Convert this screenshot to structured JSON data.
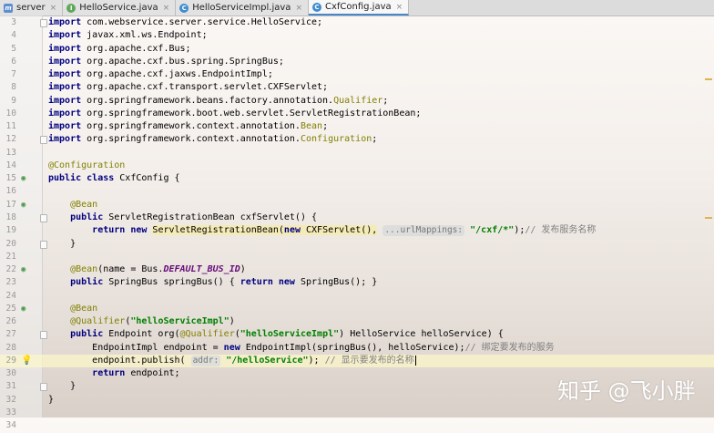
{
  "tabs": [
    {
      "label": "server",
      "icon": "module-icon",
      "active": false
    },
    {
      "label": "HelloService.java",
      "icon": "interface-icon",
      "active": false
    },
    {
      "label": "HelloServiceImpl.java",
      "icon": "class-icon",
      "active": false
    },
    {
      "label": "CxfConfig.java",
      "icon": "class-icon",
      "active": true
    }
  ],
  "close_glyph": "×",
  "line_numbers": [
    "3",
    "4",
    "5",
    "6",
    "7",
    "8",
    "9",
    "10",
    "11",
    "12",
    "13",
    "14",
    "15",
    "16",
    "17",
    "18",
    "19",
    "20",
    "21",
    "22",
    "23",
    "24",
    "25",
    "26",
    "27",
    "28",
    "29",
    "30",
    "31",
    "32",
    "33",
    "34"
  ],
  "code": {
    "import_kw": "import",
    "imports": [
      {
        "path": "com.webservice.server.service.HelloService",
        "tail": "",
        "end": ";"
      },
      {
        "path": "javax.xml.ws.Endpoint",
        "tail": "",
        "end": ";"
      },
      {
        "path": "org.apache.cxf.Bus",
        "tail": "",
        "end": ";"
      },
      {
        "path": "org.apache.cxf.bus.spring.SpringBus",
        "tail": "",
        "end": ";"
      },
      {
        "path": "org.apache.cxf.jaxws.EndpointImpl",
        "tail": "",
        "end": ";"
      },
      {
        "path": "org.apache.cxf.transport.servlet.CXFServlet",
        "tail": "",
        "end": ";"
      },
      {
        "path": "org.springframework.beans.factory.annotation.",
        "tail": "Qualifier",
        "end": ";"
      },
      {
        "path": "org.springframework.boot.web.servlet.ServletRegistrationBean",
        "tail": "",
        "end": ";"
      },
      {
        "path": "org.springframework.context.annotation.",
        "tail": "Bean",
        "end": ";"
      },
      {
        "path": "org.springframework.context.annotation.",
        "tail": "Configuration",
        "end": ";"
      }
    ],
    "annotation_configuration": "@Configuration",
    "kw_public": "public",
    "kw_class": "class",
    "class_decl_rest": " CxfConfig {",
    "annotation_bean": "@Bean",
    "servlet_sig_rest": " ServletRegistrationBean cxfServlet() {",
    "kw_return": "return",
    "kw_new": "new",
    "servlet_body_a": "ServletRegistrationBean(",
    "servlet_body_b": " CXFServlet(),",
    "servlet_hint": "...urlMappings:",
    "servlet_url": "\"/cxf/*\"",
    "servlet_end": ");",
    "servlet_comment": "// 发布服务名称",
    "close_brace": "}",
    "bean_name_prefix": "(name = Bus.",
    "bean_name_const": "DEFAULT_BUS_ID",
    "bean_name_suffix": ")",
    "springbus_sig": " SpringBus springBus() { ",
    "springbus_body": " SpringBus(); }",
    "qualifier_anno": "@Qualifier",
    "qualifier_open": "(",
    "qualifier_value": "\"helloServiceImpl\"",
    "qualifier_close": ")",
    "endpoint_sig_a": " Endpoint org(",
    "endpoint_sig_b": " HelloService helloService) {",
    "endpoint_impl_a": "EndpointImpl endpoint = ",
    "endpoint_impl_b": " EndpointImpl(springBus(), helloService);",
    "endpoint_impl_comment": "// 绑定要发布的服务",
    "publish_a": "endpoint.publish(",
    "publish_hint": "addr:",
    "publish_value": "\"/helloService\"",
    "publish_end": ");",
    "publish_comment": "// 显示要发布的名称",
    "return_rest": " endpoint;"
  },
  "gutter_icons": {
    "bean": "bean-icon",
    "bulb": "intention-bulb-icon",
    "bean_glyph": "◉",
    "bulb_glyph": "💡"
  },
  "watermark": "知乎 @飞小胖",
  "colors": {
    "keyword": "#000080",
    "annotation": "#808000",
    "string": "#008000",
    "comment": "#808080",
    "static_field": "#660e7a"
  }
}
